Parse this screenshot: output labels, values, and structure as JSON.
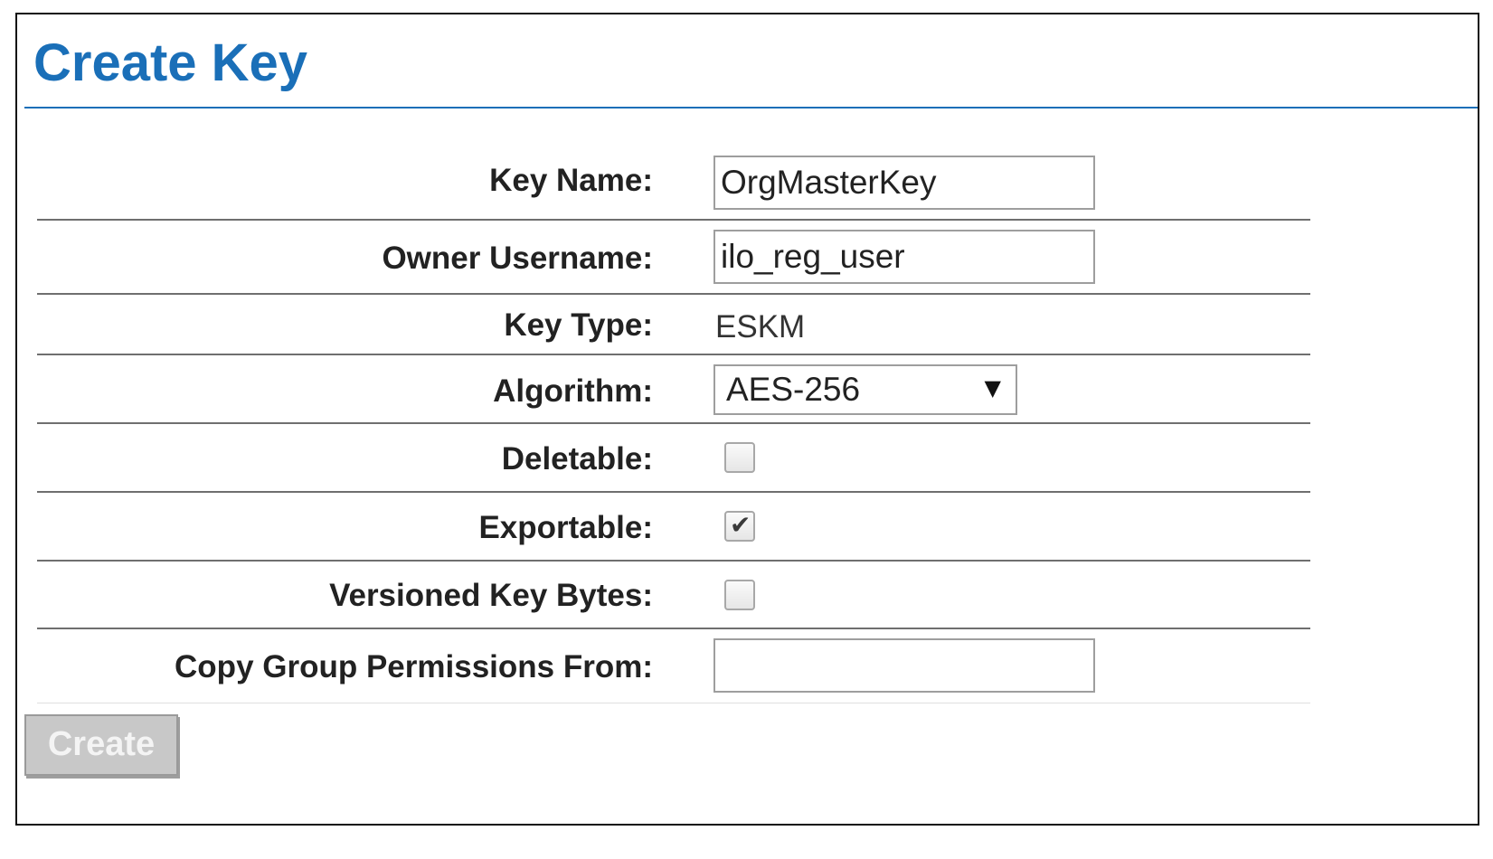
{
  "page": {
    "title": "Create Key"
  },
  "form": {
    "key_name": {
      "label": "Key Name:",
      "value": "OrgMasterKey"
    },
    "owner_username": {
      "label": "Owner Username:",
      "value": "ilo_reg_user"
    },
    "key_type": {
      "label": "Key Type:",
      "value": "ESKM"
    },
    "algorithm": {
      "label": "Algorithm:",
      "selected": "AES-256",
      "arrow_icon": "triangle-down-icon"
    },
    "deletable": {
      "label": "Deletable:",
      "checked": false
    },
    "exportable": {
      "label": "Exportable:",
      "checked": true,
      "check_glyph": "✔"
    },
    "versioned_key_bytes": {
      "label": "Versioned Key Bytes:",
      "checked": false
    },
    "copy_group_permissions": {
      "label": "Copy Group Permissions From:",
      "value": ""
    }
  },
  "actions": {
    "create_label": "Create",
    "create_enabled": false
  },
  "colors": {
    "title": "#1a6fb8",
    "rule": "#1a6fb8",
    "row_divider": "#6f6f6f",
    "disabled_button_bg": "#c8c8c8"
  }
}
